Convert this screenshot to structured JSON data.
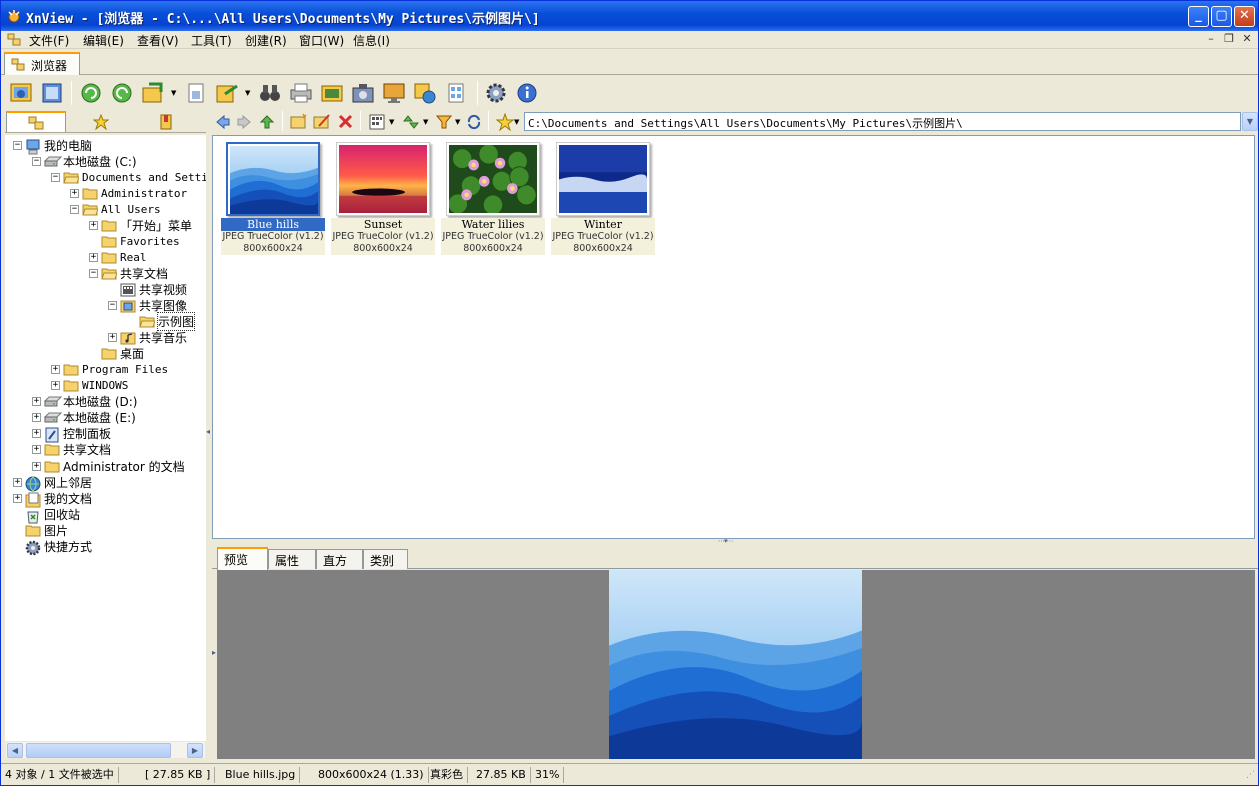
{
  "window": {
    "title": "XnView - [浏览器 - C:\\...\\All Users\\Documents\\My Pictures\\示例图片\\]",
    "minimize_icon": "minimize-icon",
    "maximize_icon": "maximize-icon",
    "close_icon": "close-icon"
  },
  "menu": [
    "文件(F)",
    "编辑(E)",
    "查看(V)",
    "工具(T)",
    "创建(R)",
    "窗口(W)",
    "信息(I)"
  ],
  "doc_tab": {
    "label": "浏览器"
  },
  "toolbar": {
    "icons": [
      "open-browser-icon",
      "fullscreen-icon",
      "refresh-icon",
      "rotate-icon",
      "convert-icon",
      "properties-icon",
      "export-icon",
      "search-binoculars-icon",
      "print-icon",
      "slideshow-icon",
      "capture-icon",
      "wallpaper-icon",
      "web-page-icon",
      "contact-sheet-icon",
      "settings-gear-icon",
      "info-icon"
    ]
  },
  "left_tabs": [
    "folders-tab-icon",
    "favorites-tab-icon",
    "categories-tab-icon"
  ],
  "tree": [
    {
      "label": "我的电脑",
      "depth": 0,
      "expander": "−",
      "icon": "my-computer-icon"
    },
    {
      "label": "本地磁盘 (C:)",
      "depth": 1,
      "expander": "−",
      "icon": "drive-icon"
    },
    {
      "label": "Documents and Setti",
      "depth": 2,
      "expander": "−",
      "icon": "folder-open-icon",
      "mono": true
    },
    {
      "label": "Administrator",
      "depth": 3,
      "expander": "+",
      "icon": "folder-icon",
      "mono": true
    },
    {
      "label": "All Users",
      "depth": 3,
      "expander": "−",
      "icon": "folder-open-icon",
      "mono": true
    },
    {
      "label": "「开始」菜单",
      "depth": 4,
      "expander": "+",
      "icon": "folder-icon"
    },
    {
      "label": "Favorites",
      "depth": 4,
      "expander": "",
      "icon": "folder-icon",
      "mono": true
    },
    {
      "label": "Real",
      "depth": 4,
      "expander": "+",
      "icon": "folder-icon",
      "mono": true
    },
    {
      "label": "共享文档",
      "depth": 4,
      "expander": "−",
      "icon": "folder-open-icon"
    },
    {
      "label": "共享视频",
      "depth": 5,
      "expander": "",
      "icon": "video-folder-icon"
    },
    {
      "label": "共享图像",
      "depth": 5,
      "expander": "−",
      "icon": "pictures-folder-icon"
    },
    {
      "label": "示例图",
      "depth": 6,
      "expander": "",
      "icon": "folder-open-icon",
      "selected": true
    },
    {
      "label": "共享音乐",
      "depth": 5,
      "expander": "+",
      "icon": "music-folder-icon"
    },
    {
      "label": "桌面",
      "depth": 4,
      "expander": "",
      "icon": "folder-icon"
    },
    {
      "label": "Program Files",
      "depth": 2,
      "expander": "+",
      "icon": "folder-icon",
      "mono": true
    },
    {
      "label": "WINDOWS",
      "depth": 2,
      "expander": "+",
      "icon": "folder-icon",
      "mono": true
    },
    {
      "label": "本地磁盘 (D:)",
      "depth": 1,
      "expander": "+",
      "icon": "drive-icon"
    },
    {
      "label": "本地磁盘 (E:)",
      "depth": 1,
      "expander": "+",
      "icon": "drive-icon"
    },
    {
      "label": "控制面板",
      "depth": 1,
      "expander": "+",
      "icon": "control-panel-icon"
    },
    {
      "label": "共享文档",
      "depth": 1,
      "expander": "+",
      "icon": "folder-icon"
    },
    {
      "label": "Administrator 的文档",
      "depth": 1,
      "expander": "+",
      "icon": "folder-icon"
    },
    {
      "label": "网上邻居",
      "depth": 0,
      "expander": "+",
      "icon": "network-icon"
    },
    {
      "label": "我的文档",
      "depth": 0,
      "expander": "+",
      "icon": "my-documents-icon"
    },
    {
      "label": "回收站",
      "depth": 0,
      "expander": "",
      "icon": "recycle-bin-icon"
    },
    {
      "label": "图片",
      "depth": 0,
      "expander": "",
      "icon": "folder-icon"
    },
    {
      "label": "快捷方式",
      "depth": 0,
      "expander": "",
      "icon": "shortcut-gear-icon"
    }
  ],
  "address": {
    "path": "C:\\Documents and Settings\\All Users\\Documents\\My Pictures\\示例图片\\"
  },
  "thumbnails": [
    {
      "name": "Blue hills",
      "format": "JPEG TrueColor (v1.2)",
      "dims": "800x600x24",
      "scene": "blue-hills",
      "selected": true
    },
    {
      "name": "Sunset",
      "format": "JPEG TrueColor (v1.2)",
      "dims": "800x600x24",
      "scene": "sunset"
    },
    {
      "name": "Water lilies",
      "format": "JPEG TrueColor (v1.2)",
      "dims": "800x600x24",
      "scene": "water-lilies"
    },
    {
      "name": "Winter",
      "format": "JPEG TrueColor (v1.2)",
      "dims": "800x600x24",
      "scene": "winter"
    }
  ],
  "preview_tabs": [
    "预览",
    "属性",
    "直方图",
    "类别"
  ],
  "status": {
    "count": "4 对象 / 1 文件被选中",
    "size": "[ 27.85 KB ]",
    "filename": "Blue hills.jpg",
    "dims": "800x600x24 (1.33)",
    "color": "真彩色",
    "filesize": "27.85 KB",
    "zoom": "31%"
  }
}
